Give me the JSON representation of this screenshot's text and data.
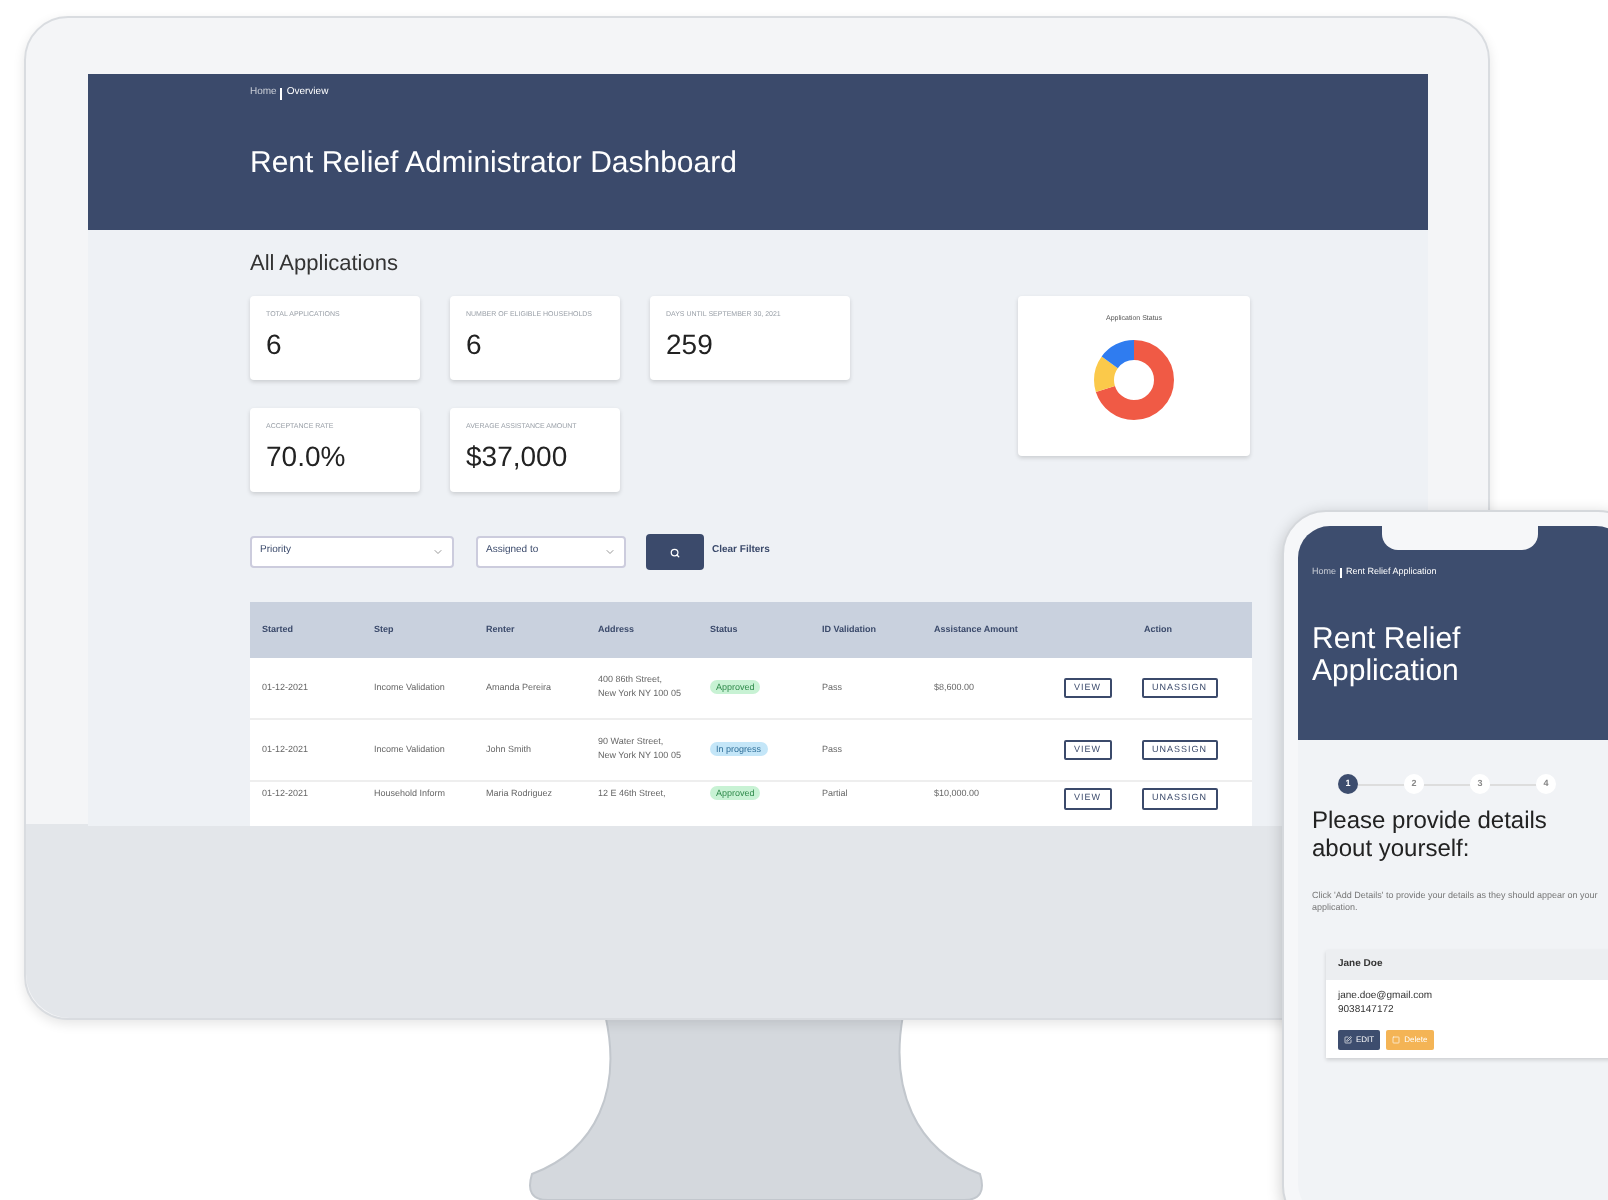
{
  "dashboard": {
    "breadcrumb": [
      "Home",
      "Overview"
    ],
    "title": "Rent Relief Administrator Dashboard",
    "section_title": "All Applications",
    "stats": [
      {
        "label": "TOTAL APPLICATIONS",
        "value": "6"
      },
      {
        "label": "NUMBER OF ELIGIBLE HOUSEHOLDS",
        "value": "6"
      },
      {
        "label": "DAYS UNTIL SEPTEMBER 30, 2021",
        "value": "259"
      },
      {
        "label": "ACCEPTANCE RATE",
        "value": "70.0%"
      },
      {
        "label": "AVERAGE ASSISTANCE AMOUNT",
        "value": "$37,000"
      }
    ],
    "status_chart": {
      "title": "Application Status"
    },
    "filters": {
      "priority": {
        "placeholder": "Priority"
      },
      "assigned": {
        "placeholder": "Assigned to"
      },
      "clear": "Clear Filters"
    },
    "table": {
      "columns": [
        "Started",
        "Step",
        "Renter",
        "Address",
        "Status",
        "ID Validation",
        "Assistance Amount",
        "Action"
      ],
      "rows": [
        {
          "started": "01-12-2021",
          "step": "Income Validation",
          "renter": "Amanda Pereira",
          "address": "400 86th Street, New York NY 100 05",
          "status": {
            "label": "Approved",
            "kind": "approved"
          },
          "id_validation": "Pass",
          "amount": "$8,600.00",
          "view": "VIEW",
          "unassign": "UNASSIGN"
        },
        {
          "started": "01-12-2021",
          "step": "Income Validation",
          "renter": "John Smith",
          "address": "90 Water Street, New York NY 100 05",
          "status": {
            "label": "In progress",
            "kind": "progress"
          },
          "id_validation": "Pass",
          "amount": "",
          "view": "VIEW",
          "unassign": "UNASSIGN"
        },
        {
          "started": "01-12-2021",
          "step": "Household Inform",
          "renter": "Maria Rodriguez",
          "address": "12 E 46th Street,",
          "status": {
            "label": "Approved",
            "kind": "approved"
          },
          "id_validation": "Partial",
          "amount": "$10,000.00",
          "view": "VIEW",
          "unassign": "UNASSIGN"
        }
      ]
    }
  },
  "phone": {
    "breadcrumb": [
      "Home",
      "Rent Relief Application"
    ],
    "title": "Rent Relief Application",
    "steps": [
      {
        "label": "1",
        "selected": true
      },
      {
        "label": "2",
        "selected": false
      },
      {
        "label": "3",
        "selected": false
      },
      {
        "label": "4",
        "selected": false
      }
    ],
    "heading": "Please provide details about yourself:",
    "hint": "Click 'Add Details' to provide your details as they should appear on your application.",
    "person": {
      "name": "Jane Doe",
      "email": "jane.doe@gmail.com",
      "phone": "9038147172",
      "edit": "EDIT",
      "delete": "Delete"
    }
  }
}
